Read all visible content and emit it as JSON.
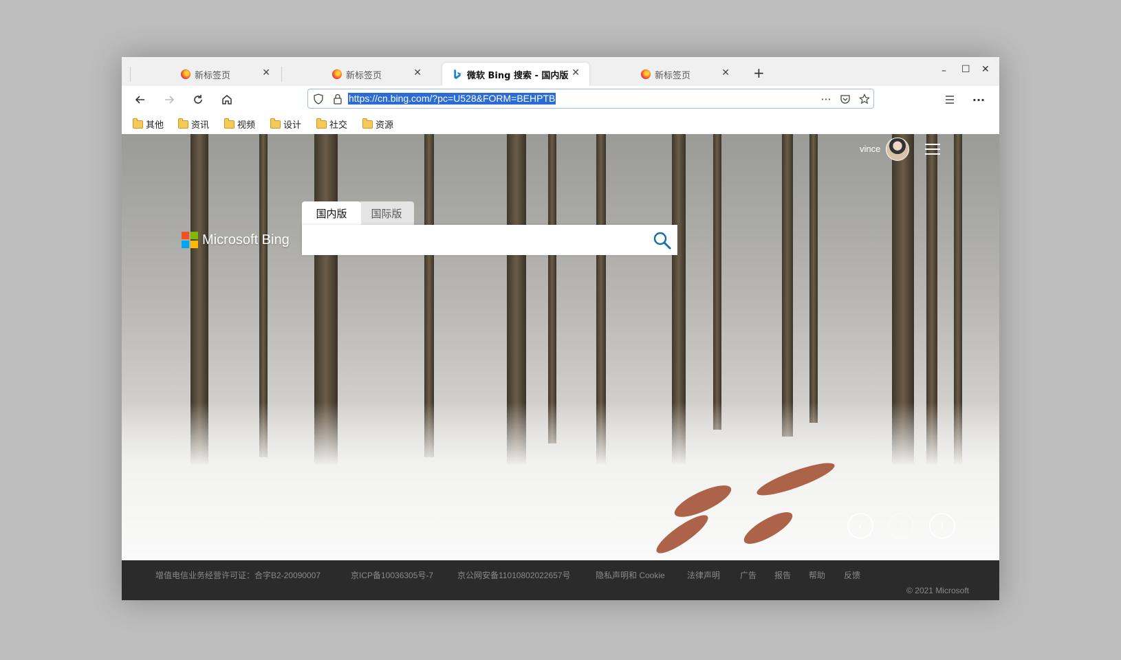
{
  "tabs": [
    {
      "title": "新标签页",
      "icon": "firefox-icon",
      "active": false
    },
    {
      "title": "新标签页",
      "icon": "firefox-icon",
      "active": false
    },
    {
      "title": "微软 Bing 搜索 - 国内版",
      "icon": "bing-icon",
      "active": true
    },
    {
      "title": "新标签页",
      "icon": "firefox-icon",
      "active": false
    }
  ],
  "address_bar": {
    "url": "https://cn.bing.com/?pc=U528&FORM=BEHPTB"
  },
  "bookmarks": [
    "其他",
    "资讯",
    "视频",
    "设计",
    "社交",
    "资源"
  ],
  "page": {
    "user_name": "vince",
    "logo_text": "Microsoft Bing",
    "search_tabs": [
      "国内版",
      "国际版"
    ],
    "footer_links": [
      "增值电信业务经营许可证：合字B2-20090007",
      "京ICP备10036305号-7",
      "京公网安备11010802022657号",
      "隐私声明和 Cookie",
      "法律声明",
      "广告",
      "报告",
      "帮助",
      "反馈"
    ],
    "copyright": "© 2021 Microsoft"
  },
  "colors": {
    "accent": "#2a6bd6",
    "footer_bg": "#2b2b2b",
    "search_icon": "#1a6fa8"
  }
}
